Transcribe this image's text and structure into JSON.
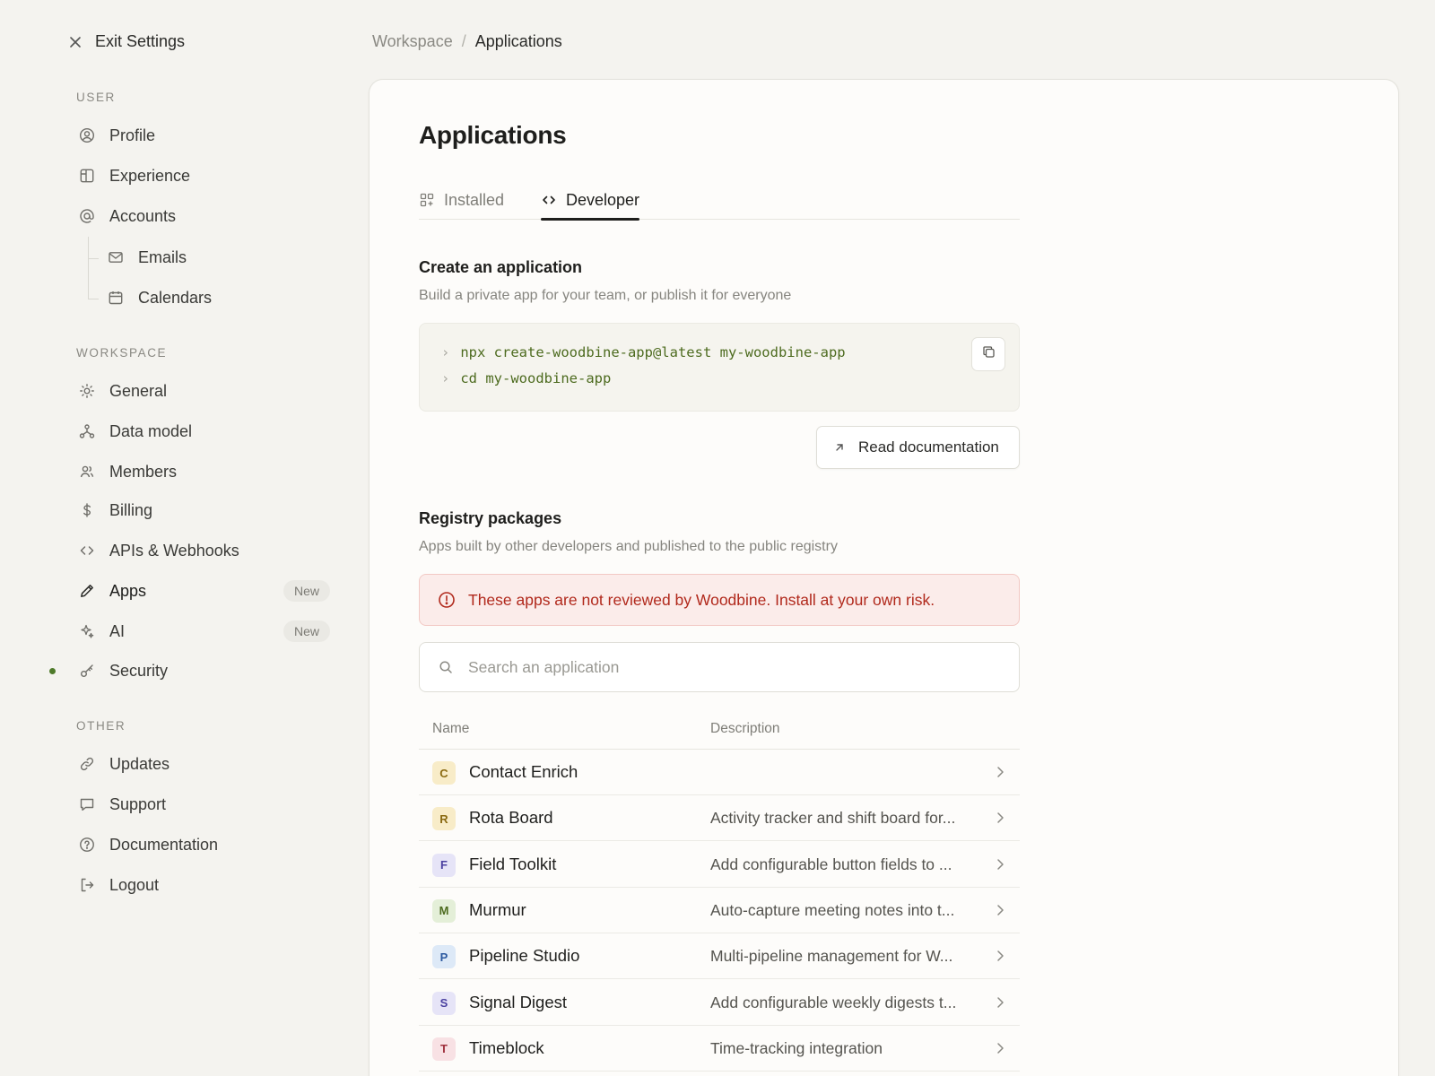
{
  "sidebar": {
    "exit_label": "Exit Settings",
    "sections": {
      "user": "USER",
      "workspace": "WORKSPACE",
      "other": "OTHER"
    },
    "user_items": [
      {
        "label": "Profile",
        "icon": "user-circle-icon"
      },
      {
        "label": "Experience",
        "icon": "layout-icon"
      },
      {
        "label": "Accounts",
        "icon": "at-sign-icon"
      },
      {
        "label": "Emails",
        "icon": "mail-icon"
      },
      {
        "label": "Calendars",
        "icon": "calendar-icon"
      }
    ],
    "workspace_items": [
      {
        "label": "General",
        "icon": "sun-icon"
      },
      {
        "label": "Data model",
        "icon": "data-model-icon"
      },
      {
        "label": "Members",
        "icon": "users-icon"
      },
      {
        "label": "Billing",
        "icon": "dollar-icon"
      },
      {
        "label": "APIs & Webhooks",
        "icon": "code-icon"
      },
      {
        "label": "Apps",
        "icon": "pencil-icon",
        "badge": "New"
      },
      {
        "label": "AI",
        "icon": "sparkles-icon",
        "badge": "New"
      },
      {
        "label": "Security",
        "icon": "key-icon"
      }
    ],
    "other_items": [
      {
        "label": "Updates",
        "icon": "link-icon"
      },
      {
        "label": "Support",
        "icon": "message-icon"
      },
      {
        "label": "Documentation",
        "icon": "help-circle-icon"
      },
      {
        "label": "Logout",
        "icon": "logout-icon"
      }
    ]
  },
  "breadcrumb": {
    "parent": "Workspace",
    "separator": "/",
    "current": "Applications"
  },
  "main": {
    "title": "Applications",
    "tabs": [
      {
        "label": "Installed",
        "icon": "grid-plus-icon",
        "active": false
      },
      {
        "label": "Developer",
        "icon": "code-icon",
        "active": true
      }
    ],
    "create": {
      "title": "Create an application",
      "subtitle": "Build a private app for your team, or publish it for everyone",
      "commands": [
        {
          "prompt": "›",
          "cmd": "npx create-woodbine-app@latest my-woodbine-app"
        },
        {
          "prompt": "›",
          "cmd": "cd my-woodbine-app"
        }
      ],
      "doc_button": "Read documentation"
    },
    "registry": {
      "title": "Registry packages",
      "subtitle": "Apps built by other developers and published to the public registry",
      "warning": "These apps are not reviewed by Woodbine. Install at your own risk.",
      "search_placeholder": "Search an application",
      "columns": {
        "name": "Name",
        "description": "Description"
      },
      "rows": [
        {
          "letter": "C",
          "name": "Contact Enrich",
          "description": "",
          "bg": "#f8ecc8",
          "fg": "#8a6a12"
        },
        {
          "letter": "R",
          "name": "Rota Board",
          "description": "Activity tracker and shift board for...",
          "bg": "#f8ecc8",
          "fg": "#8a6a12"
        },
        {
          "letter": "F",
          "name": "Field Toolkit",
          "description": "Add configurable button fields to ...",
          "bg": "#e6e4f7",
          "fg": "#4a40a0"
        },
        {
          "letter": "M",
          "name": "Murmur",
          "description": "Auto-capture meeting notes into t...",
          "bg": "#e4efd8",
          "fg": "#4d6b1f"
        },
        {
          "letter": "P",
          "name": "Pipeline Studio",
          "description": "Multi-pipeline management for W...",
          "bg": "#dde9f7",
          "fg": "#2d5aa0"
        },
        {
          "letter": "S",
          "name": "Signal Digest",
          "description": "Add configurable weekly digests t...",
          "bg": "#e6e4f7",
          "fg": "#4a40a0"
        },
        {
          "letter": "T",
          "name": "Timeblock",
          "description": "Time-tracking integration",
          "bg": "#f8e1e4",
          "fg": "#a0303d"
        }
      ]
    }
  },
  "colors": {
    "background": "#f4f3ef",
    "panel": "#fdfcfa",
    "accent_green": "#4e7a2a",
    "warning_text": "#b1291c",
    "warning_bg": "#fbecea"
  }
}
